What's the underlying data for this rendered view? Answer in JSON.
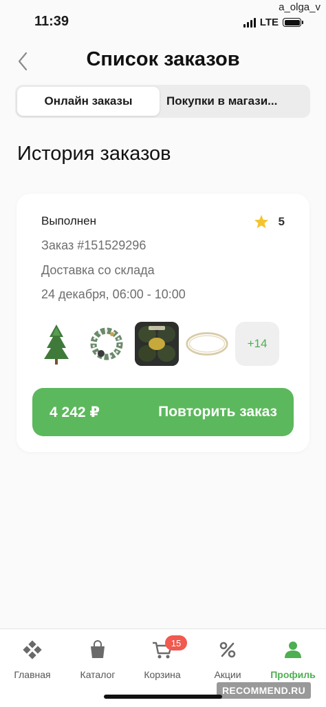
{
  "status_bar": {
    "time": "11:39",
    "network": "LTE",
    "watermark_user": "a_olga_v"
  },
  "header": {
    "title": "Список заказов",
    "back_icon": "chevron-left-icon"
  },
  "tabs": [
    {
      "label": "Онлайн заказы",
      "active": true
    },
    {
      "label": "Покупки в магази...",
      "active": false
    }
  ],
  "section_title": "История заказов",
  "order": {
    "status": "Выполнен",
    "rating": "5",
    "number": "Заказ #151529296",
    "delivery": "Доставка со склада",
    "datetime": "24 декабря, 06:00 - 10:00",
    "items": [
      "christmas-tree",
      "wreath",
      "avocado-pack",
      "light-garland"
    ],
    "more_count": "+14",
    "price": "4 242 ₽",
    "repeat_label": "Повторить заказ"
  },
  "bottom_nav": [
    {
      "label": "Главная",
      "icon": "home-diamonds-icon",
      "active": false
    },
    {
      "label": "Каталог",
      "icon": "bag-icon",
      "active": false
    },
    {
      "label": "Корзина",
      "icon": "cart-icon",
      "active": false,
      "badge": "15"
    },
    {
      "label": "Акции",
      "icon": "percent-icon",
      "active": false
    },
    {
      "label": "Профиль",
      "icon": "profile-icon",
      "active": true
    }
  ],
  "colors": {
    "accent": "#5cb85c",
    "badge": "#f05a4f",
    "muted_text": "#6e6e6e"
  },
  "watermark_brand": "RECOMMEND.RU"
}
